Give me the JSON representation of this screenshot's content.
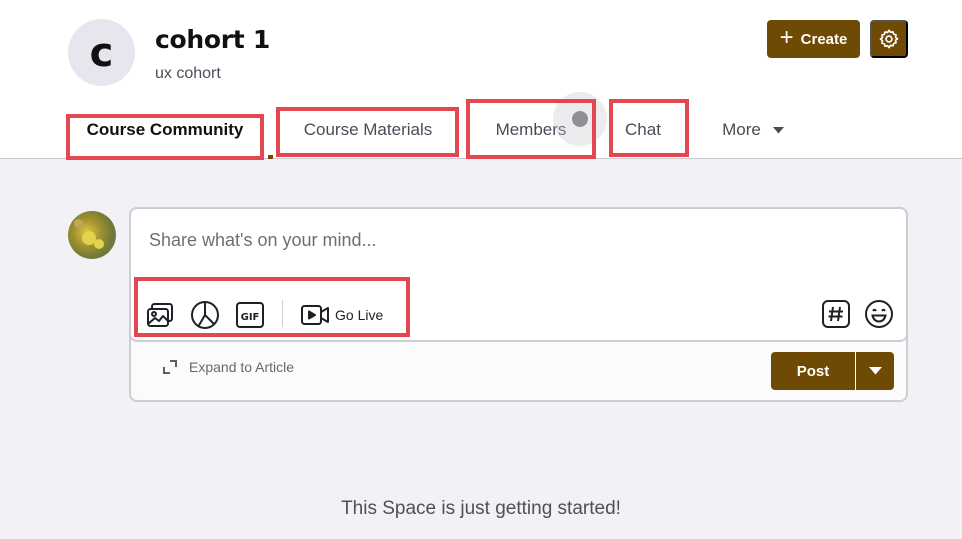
{
  "space": {
    "avatar_letter": "c",
    "title": "cohort 1",
    "subtitle": "ux cohort"
  },
  "actions": {
    "create_label": "Create",
    "create_icon": "plus-icon",
    "settings_icon": "gear-icon"
  },
  "tabs": [
    {
      "label": "Course Community",
      "active": true
    },
    {
      "label": "Course Materials",
      "active": false
    },
    {
      "label": "Members",
      "active": false
    },
    {
      "label": "Chat",
      "active": false
    },
    {
      "label": "More",
      "active": false,
      "icon": "caret-down-icon"
    }
  ],
  "composer": {
    "placeholder": "Share what's on your mind...",
    "tools": [
      "image-icon",
      "poll-icon",
      "gif-icon"
    ],
    "go_live_label": "Go Live",
    "hashtag_icon": "hashtag-icon",
    "emoji_icon": "emoji-icon",
    "expand_label": "Expand to Article",
    "post_label": "Post"
  },
  "empty_state": {
    "message": "This Space is just getting started!"
  },
  "colors": {
    "brand": "#6f4a04",
    "highlight": "#e3474f",
    "background": "#f1f1f6"
  }
}
